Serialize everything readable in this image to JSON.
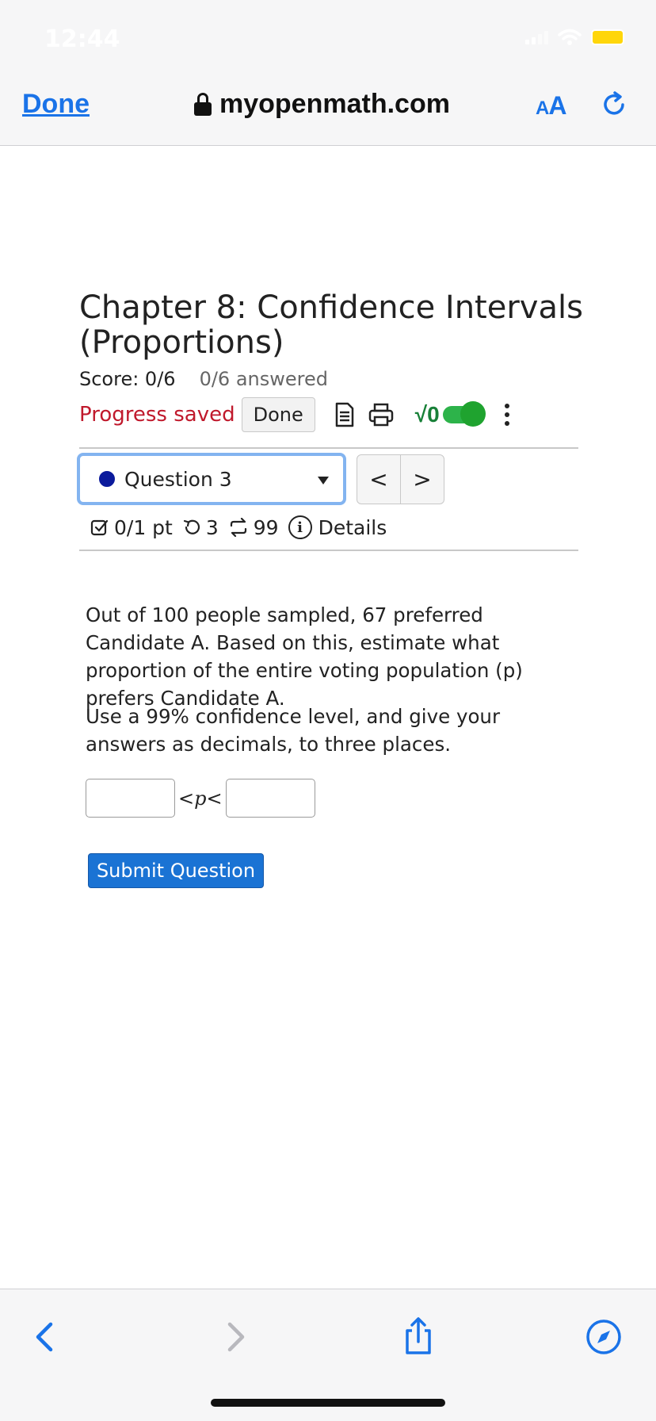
{
  "status_bar": {
    "time": "12:44"
  },
  "browser": {
    "done_label": "Done",
    "url": "myopenmath.com",
    "text_size_label_small": "A",
    "text_size_label_large": "A"
  },
  "assessment": {
    "title": "Chapter 8: Confidence Intervals (Proportions)",
    "score": "Score: 0/6",
    "answered": "0/6 answered",
    "progress_saved": "Progress saved",
    "done_button": "Done",
    "math_toggle_label": "√0"
  },
  "question_nav": {
    "selected": "Question 3",
    "prev": "<",
    "next": ">"
  },
  "question_meta": {
    "points": "0/1 pt",
    "retries": "3",
    "regenerations": "99",
    "details": "Details"
  },
  "question": {
    "paragraph1": "Out of 100 people sampled, 67 preferred Candidate A. Based on this, estimate what proportion of the entire voting population (p) prefers Candidate A.",
    "paragraph2": "Use a 99% confidence level, and give your answers as decimals, to three places.",
    "lower_value": "",
    "upper_value": "",
    "inequality_left": "<",
    "variable": "p",
    "inequality_right": "<",
    "submit_label": "Submit Question"
  },
  "colors": {
    "link_blue": "#1a73e8",
    "progress_red": "#c0192c",
    "submit_blue": "#1a73d4",
    "toggle_green": "#2db34a",
    "battery_yellow": "#ffd60a"
  }
}
